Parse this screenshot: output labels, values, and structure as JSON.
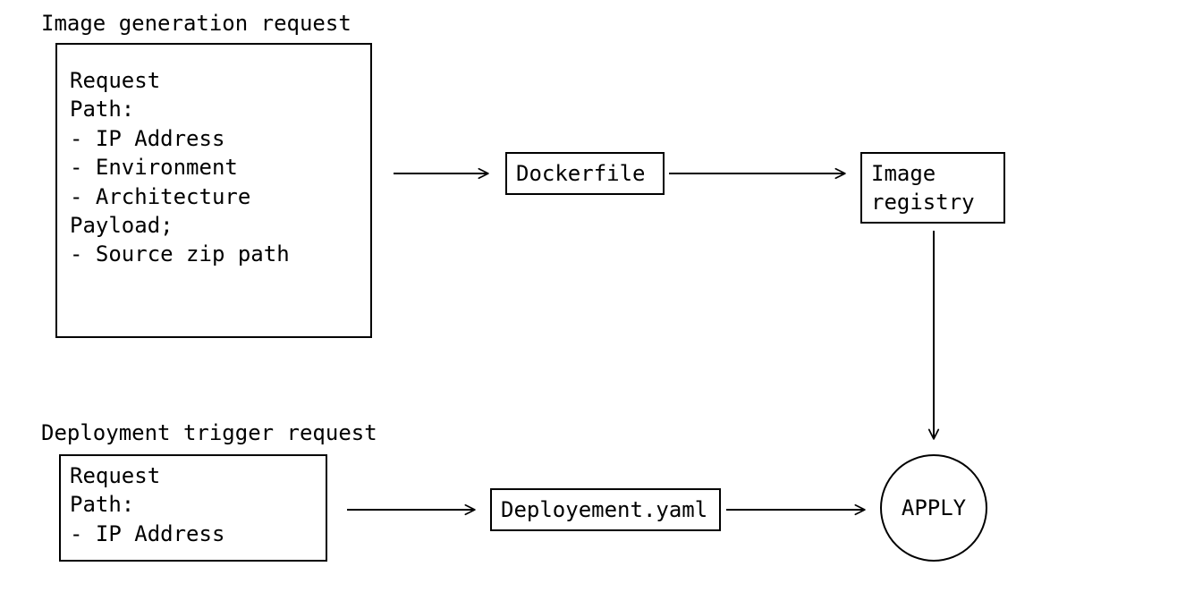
{
  "diagram": {
    "title_image_gen": "Image generation request",
    "title_deploy": "Deployment trigger request",
    "request_box": "Request\nPath:\n- IP Address\n- Environment\n- Architecture\nPayload;\n- Source zip path",
    "dockerfile_box": "Dockerfile",
    "registry_box": "Image\nregistry",
    "deploy_request_box": "Request\nPath:\n- IP Address",
    "deployment_yaml_box": "Deployement.yaml",
    "apply_circle": "APPLY"
  }
}
